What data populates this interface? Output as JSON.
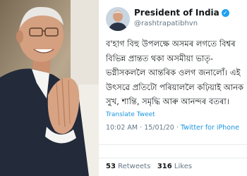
{
  "tweet": {
    "author_name": "President of India",
    "verified_icon": "verified-badge-icon",
    "author_handle": "@rashtrapatibhvn",
    "text_lines": [
      "ব'হাগ বিহু উপলক্ষে অসমৰ লগতে বিশ্বৰ",
      "বিভিন্ন প্ৰান্তত থকা অসমীয়া ভাতৃ-",
      "ভগ্নীসকললৈ আন্তৰিক ওলগ জনালোঁ। এই",
      "উৎসৱে প্ৰতিটো পৰিয়াললৈ কঢ়িয়াই আনক",
      "সুখ, শান্তি, সমৃদ্ধি আৰু আনন্দৰ বতৰা।"
    ],
    "translate_label": "Translate Tweet",
    "time": "10:02 AM",
    "date": "15/01/20",
    "separator": "·",
    "app": "Twitter for iPhone",
    "retweets_count": "53",
    "retweets_label": "Retweets",
    "likes_count": "316",
    "likes_label": "Likes"
  },
  "colors": {
    "link": "#1b95e0",
    "verified": "#1da1f2",
    "text": "#14171a",
    "muted": "#657786",
    "border": "#e6ecf0"
  }
}
